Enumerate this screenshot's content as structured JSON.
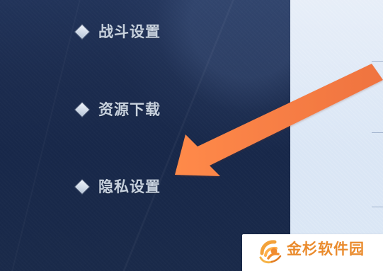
{
  "menu": {
    "items": [
      {
        "label": "战斗设置"
      },
      {
        "label": "资源下载"
      },
      {
        "label": "隐私设置"
      }
    ]
  },
  "watermark": {
    "label": "金杉软件园"
  },
  "icons": {
    "menu_marker": "diamond-icon",
    "pointer": "arrow-icon",
    "watermark_logo": "watermark-logo-icon"
  },
  "colors": {
    "sidebar_dark": "#1c2c4f",
    "sidebar_light": "#22345a",
    "panel_light": "#dbe7f5",
    "menu_text": "#c7d1dd",
    "arrow": "#f17d43",
    "watermark_text": "#ea8b2d"
  }
}
